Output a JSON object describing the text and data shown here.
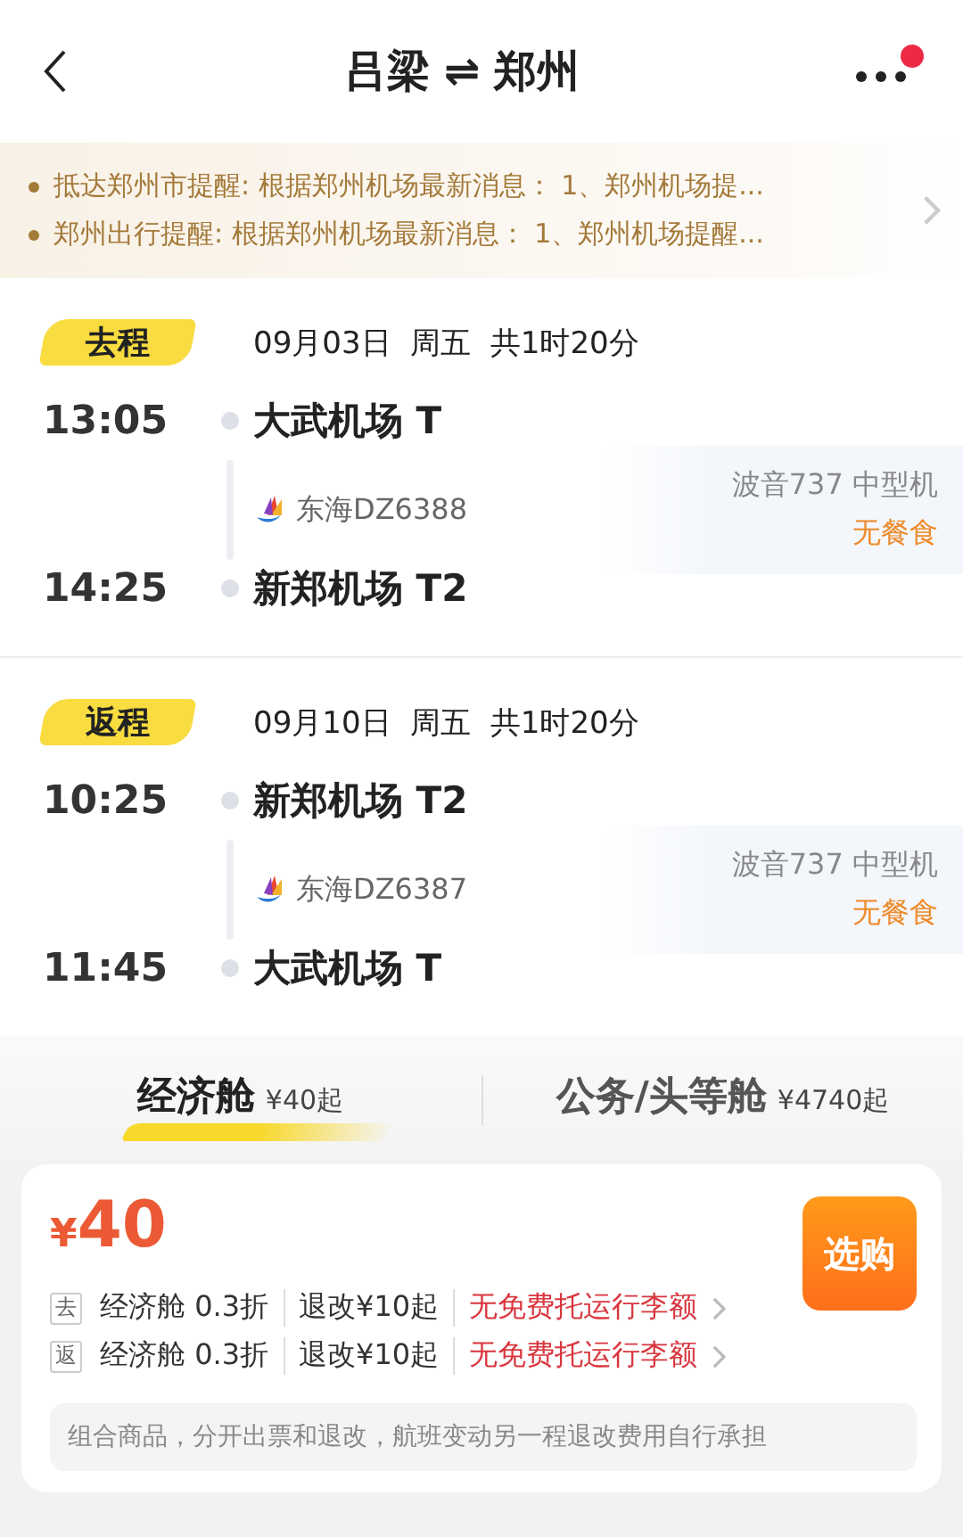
{
  "header": {
    "origin": "吕梁",
    "swap": "⇌",
    "destination": "郑州",
    "has_notification": true
  },
  "notices": [
    "抵达郑州市提醒: 根据郑州机场最新消息：  1、郑州机场提...",
    "郑州出行提醒: 根据郑州机场最新消息：  1、郑州机场提醒..."
  ],
  "legs": [
    {
      "tag": "去程",
      "date": "09月03日",
      "weekday": "周五",
      "duration": "共1时20分",
      "depart_time": "13:05",
      "depart_airport": "大武机场 T",
      "airline": "东海DZ6388",
      "aircraft": "波音737 中型机",
      "meal": "无餐食",
      "arrive_time": "14:25",
      "arrive_airport": "新郑机场 T2"
    },
    {
      "tag": "返程",
      "date": "09月10日",
      "weekday": "周五",
      "duration": "共1时20分",
      "depart_time": "10:25",
      "depart_airport": "新郑机场 T2",
      "airline": "东海DZ6387",
      "aircraft": "波音737 中型机",
      "meal": "无餐食",
      "arrive_time": "11:45",
      "arrive_airport": "大武机场 T"
    }
  ],
  "cabin_tabs": [
    {
      "label": "经济舱",
      "price": "¥40起",
      "selected": true
    },
    {
      "label": "公务/头等舱",
      "price": "¥4740起",
      "selected": false
    }
  ],
  "offer": {
    "currency": "¥",
    "price": "40",
    "buy_button": "选购",
    "rules": [
      {
        "leg": "去",
        "cabin": "经济舱 0.3折",
        "change": "退改¥10起",
        "baggage": "无免费托运行李额"
      },
      {
        "leg": "返",
        "cabin": "经济舱 0.3折",
        "change": "退改¥10起",
        "baggage": "无免费托运行李额"
      }
    ],
    "note": "组合商品，分开出票和退改，航班变动另一程退改费用自行承担"
  }
}
